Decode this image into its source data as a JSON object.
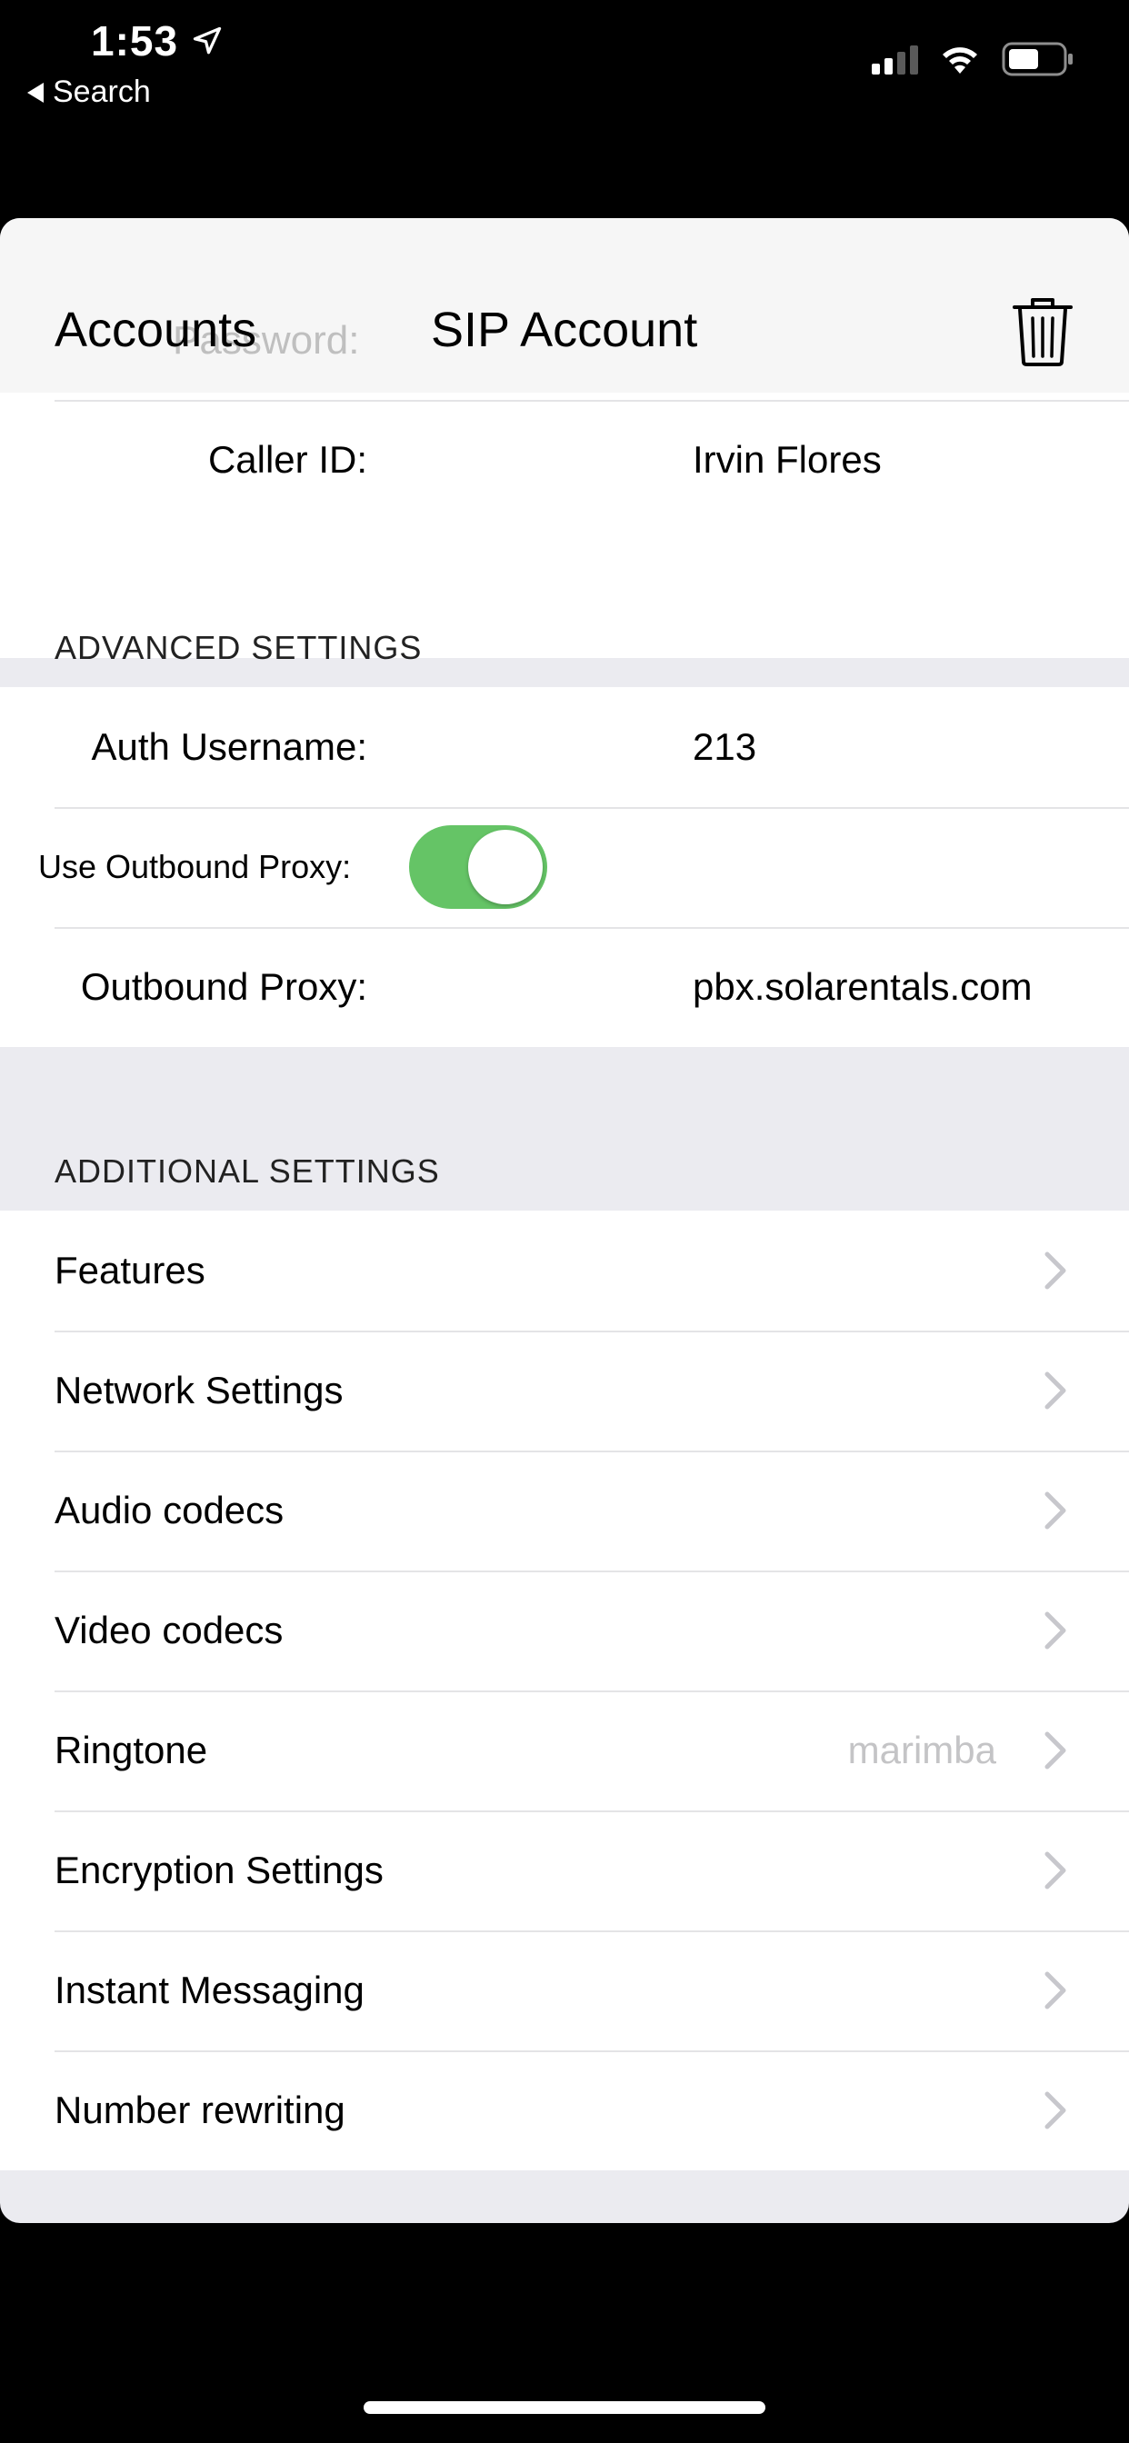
{
  "status_bar": {
    "time": "1:53",
    "back_app": "Search"
  },
  "nav": {
    "back_label": "Accounts",
    "title": "SIP Account",
    "ghost_label": "Password:"
  },
  "account": {
    "caller_id_label": "Caller ID:",
    "caller_id_value": "Irvin Flores"
  },
  "advanced": {
    "header": "ADVANCED SETTINGS",
    "auth_username_label": "Auth Username:",
    "auth_username_value": "213",
    "use_outbound_proxy_label": "Use Outbound Proxy:",
    "use_outbound_proxy_on": true,
    "outbound_proxy_label": "Outbound Proxy:",
    "outbound_proxy_value": "pbx.solarentals.com"
  },
  "additional": {
    "header": "ADDITIONAL SETTINGS",
    "items": [
      {
        "label": "Features",
        "detail": ""
      },
      {
        "label": "Network Settings",
        "detail": ""
      },
      {
        "label": "Audio codecs",
        "detail": ""
      },
      {
        "label": "Video codecs",
        "detail": ""
      },
      {
        "label": "Ringtone",
        "detail": "marimba"
      },
      {
        "label": "Encryption Settings",
        "detail": ""
      },
      {
        "label": "Instant Messaging",
        "detail": ""
      },
      {
        "label": "Number rewriting",
        "detail": ""
      }
    ]
  },
  "colors": {
    "toggle_on": "#65c466",
    "grouped_background": "#ebebf0"
  },
  "icons": [
    "location-arrow-icon",
    "back-triangle-icon",
    "cellular-signal-icon",
    "wifi-icon",
    "battery-icon",
    "trash-icon",
    "chevron-right-icon"
  ]
}
